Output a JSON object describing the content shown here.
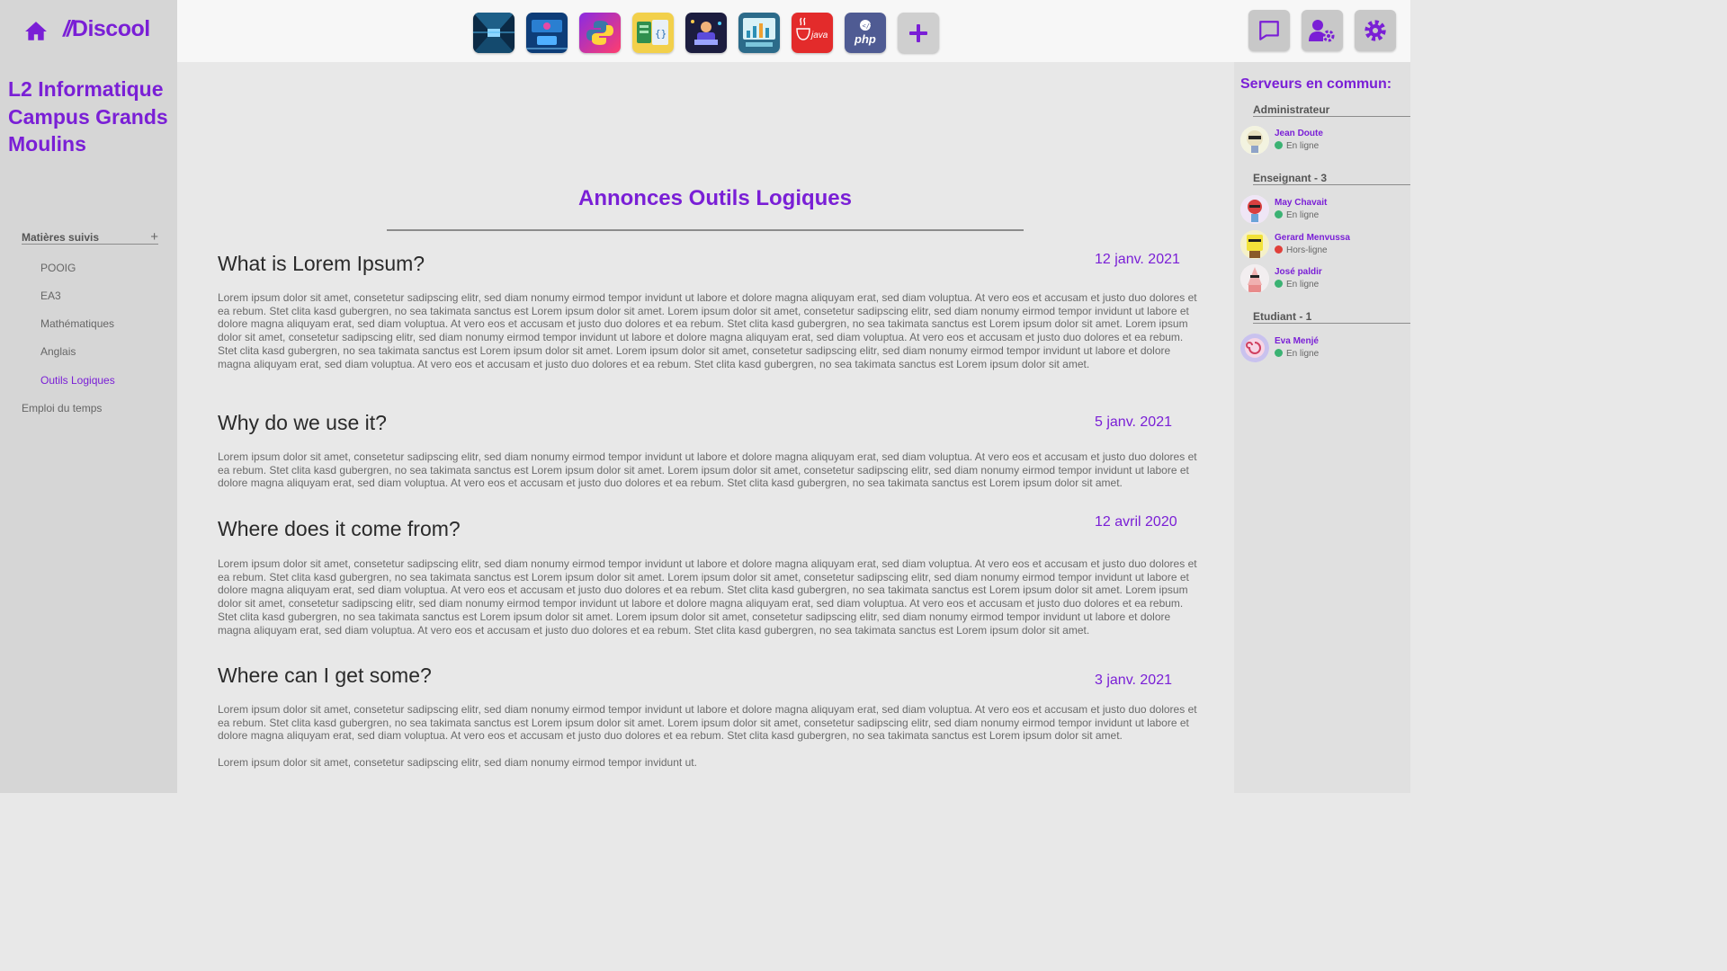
{
  "app": {
    "brand": "Discool"
  },
  "colors": {
    "accent": "#7a1fd6",
    "online": "#3bb273",
    "offline": "#e0403a"
  },
  "servers": [
    {
      "name": "server-tunnel",
      "icon": "corridor-icon"
    },
    {
      "name": "server-tech",
      "icon": "circuit-icon"
    },
    {
      "name": "server-python",
      "icon": "python-icon"
    },
    {
      "name": "server-code",
      "icon": "code-file-icon"
    },
    {
      "name": "server-dev",
      "icon": "developer-icon"
    },
    {
      "name": "server-analytics",
      "icon": "analytics-icon"
    },
    {
      "name": "server-java",
      "label": "java",
      "icon": "java-icon"
    },
    {
      "name": "server-php",
      "label": "php",
      "icon": "php-icon"
    }
  ],
  "left": {
    "group_title": "L2 Informatique Campus Grands Moulins",
    "section_head": "Matières suivis",
    "subjects": [
      "POOIG",
      "EA3",
      "Mathématiques",
      "Anglais",
      "Outils Logiques"
    ],
    "active_subject": "Outils Logiques",
    "schedule": "Emploi du temps"
  },
  "main": {
    "title": "Annonces Outils Logiques",
    "announcements": [
      {
        "title": "What is Lorem Ipsum?",
        "date": "12 janv. 2021",
        "body": "Lorem ipsum dolor sit amet, consetetur sadipscing elitr, sed diam nonumy eirmod tempor invidunt ut labore et dolore magna aliquyam erat, sed diam voluptua. At vero eos et accusam et justo duo dolores et ea rebum. Stet clita kasd gubergren, no sea takimata sanctus est Lorem ipsum dolor sit amet. Lorem ipsum dolor sit amet, consetetur sadipscing elitr, sed diam nonumy eirmod tempor invidunt ut labore et dolore magna aliquyam erat, sed diam voluptua. At vero eos et accusam et justo duo dolores et ea rebum. Stet clita kasd gubergren, no sea takimata sanctus est Lorem ipsum dolor sit amet. Lorem ipsum dolor sit amet, consetetur sadipscing elitr, sed diam nonumy eirmod tempor invidunt ut labore et dolore magna aliquyam erat, sed diam voluptua. At vero eos et accusam et justo duo dolores et ea rebum. Stet clita kasd gubergren, no sea takimata sanctus est Lorem ipsum dolor sit amet. Lorem ipsum dolor sit amet, consetetur sadipscing elitr, sed diam nonumy eirmod tempor invidunt ut labore et dolore magna aliquyam erat, sed diam voluptua. At vero eos et accusam et justo duo dolores et ea rebum. Stet clita kasd gubergren, no sea takimata sanctus est Lorem ipsum dolor sit amet."
      },
      {
        "title": "Why do we use it?",
        "date": "5 janv. 2021",
        "body": "Lorem ipsum dolor sit amet, consetetur sadipscing elitr, sed diam nonumy eirmod tempor invidunt ut labore et dolore magna aliquyam erat, sed diam voluptua. At vero eos et accusam et justo duo dolores et ea rebum. Stet clita kasd gubergren, no sea takimata sanctus est Lorem ipsum dolor sit amet. Lorem ipsum dolor sit amet, consetetur sadipscing elitr, sed diam nonumy eirmod tempor invidunt ut labore et dolore magna aliquyam erat, sed diam voluptua. At vero eos et accusam et justo duo dolores et ea rebum. Stet clita kasd gubergren, no sea takimata sanctus est Lorem ipsum dolor sit amet."
      },
      {
        "title": "Where does it come from?",
        "date": "12 avril 2020",
        "body": "Lorem ipsum dolor sit amet, consetetur sadipscing elitr, sed diam nonumy eirmod tempor invidunt ut labore et dolore magna aliquyam erat, sed diam voluptua. At vero eos et accusam et justo duo dolores et ea rebum. Stet clita kasd gubergren, no sea takimata sanctus est Lorem ipsum dolor sit amet. Lorem ipsum dolor sit amet, consetetur sadipscing elitr, sed diam nonumy eirmod tempor invidunt ut labore et dolore magna aliquyam erat, sed diam voluptua. At vero eos et accusam et justo duo dolores et ea rebum. Stet clita kasd gubergren, no sea takimata sanctus est Lorem ipsum dolor sit amet. Lorem ipsum dolor sit amet, consetetur sadipscing elitr, sed diam nonumy eirmod tempor invidunt ut labore et dolore magna aliquyam erat, sed diam voluptua. At vero eos et accusam et justo duo dolores et ea rebum. Stet clita kasd gubergren, no sea takimata sanctus est Lorem ipsum dolor sit amet. Lorem ipsum dolor sit amet, consetetur sadipscing elitr, sed diam nonumy eirmod tempor invidunt ut labore et dolore magna aliquyam erat, sed diam voluptua. At vero eos et accusam et justo duo dolores et ea rebum. Stet clita kasd gubergren, no sea takimata sanctus est Lorem ipsum dolor sit amet."
      },
      {
        "title": "Where can I get some?",
        "date": "3 janv. 2021",
        "body": "Lorem ipsum dolor sit amet, consetetur sadipscing elitr, sed diam nonumy eirmod tempor invidunt ut labore et dolore magna aliquyam erat, sed diam voluptua. At vero eos et accusam et justo duo dolores et ea rebum. Stet clita kasd gubergren, no sea takimata sanctus est Lorem ipsum dolor sit amet. Lorem ipsum dolor sit amet, consetetur sadipscing elitr, sed diam nonumy eirmod tempor invidunt ut labore et dolore magna aliquyam erat, sed diam voluptua. At vero eos et accusam et justo duo dolores et ea rebum. Stet clita kasd gubergren, no sea takimata sanctus est Lorem ipsum dolor sit amet.",
        "body2": "Lorem ipsum dolor sit amet, consetetur sadipscing elitr, sed diam nonumy eirmod tempor invidunt ut."
      }
    ]
  },
  "right": {
    "title": "Serveurs en commun:",
    "roles": [
      {
        "label": "Administrateur",
        "members": [
          {
            "name": "Jean Doute",
            "status": "En ligne",
            "online": true
          }
        ]
      },
      {
        "label": "Enseignant - 3",
        "members": [
          {
            "name": "May Chavait",
            "status": "En ligne",
            "online": true
          },
          {
            "name": "Gerard Menvussa",
            "status": "Hors-ligne",
            "online": false
          },
          {
            "name": "José paldir",
            "status": "En ligne",
            "online": true
          }
        ]
      },
      {
        "label": "Etudiant - 1",
        "members": [
          {
            "name": "Eva Menjé",
            "status": "En ligne",
            "online": true
          }
        ]
      }
    ]
  }
}
